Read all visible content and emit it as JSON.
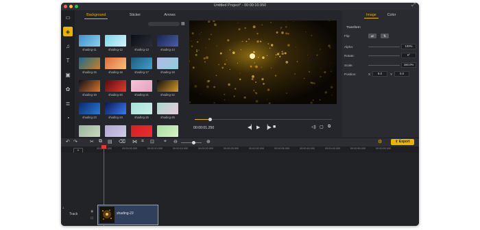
{
  "window": {
    "title": "Untitled Project* - 00:00:10.950"
  },
  "left_panel": {
    "tabs": [
      {
        "label": "Background",
        "active": true
      },
      {
        "label": "Sticker"
      },
      {
        "label": "Arrows"
      }
    ],
    "thumbnails": [
      {
        "label": "shading-11",
        "colors": [
          "#3e8fc9",
          "#8ed0f0"
        ]
      },
      {
        "label": "shading-12",
        "colors": [
          "#7ad6e8",
          "#d6f2f8"
        ]
      },
      {
        "label": "shading-13",
        "colors": [
          "#0b0d12",
          "#2b2f38"
        ]
      },
      {
        "label": "shading-14",
        "colors": [
          "#1a2450",
          "#4a5ea8"
        ]
      },
      {
        "label": "shading-15",
        "colors": [
          "#1a6a8a",
          "#c97f2a"
        ]
      },
      {
        "label": "shading-16",
        "colors": [
          "#e06a3a",
          "#f7c07a"
        ]
      },
      {
        "label": "shading-17",
        "colors": [
          "#1e5a80",
          "#3fa0c8"
        ]
      },
      {
        "label": "shading-18",
        "colors": [
          "#b7b8e8",
          "#8bd0d8"
        ]
      },
      {
        "label": "shading-19",
        "colors": [
          "#0f0f1a",
          "#d9762a"
        ]
      },
      {
        "label": "shading-20",
        "colors": [
          "#5a0a12",
          "#e23b2c"
        ]
      },
      {
        "label": "shading-21",
        "colors": [
          "#f4c4d6",
          "#e8a0c0"
        ]
      },
      {
        "label": "shading-22",
        "colors": [
          "#101010",
          "#d99a2a"
        ]
      },
      {
        "label": "shading-23",
        "colors": [
          "#0a2a70",
          "#2a7ad0"
        ]
      },
      {
        "label": "shading-24",
        "colors": [
          "#0a1a50",
          "#3a7af0"
        ]
      },
      {
        "label": "shading-25",
        "colors": [
          "#a8e0d8",
          "#c8efe8"
        ]
      },
      {
        "label": "shading-26",
        "colors": [
          "#a8dcd0",
          "#e8c8d8"
        ]
      },
      {
        "label": "",
        "colors": [
          "#9ab6a0",
          "#c8d8c0"
        ]
      },
      {
        "label": "",
        "colors": [
          "#b0a8d0",
          "#d0c8e8"
        ]
      },
      {
        "label": "",
        "colors": [
          "#d81e1e",
          "#e83030"
        ]
      },
      {
        "label": "",
        "colors": [
          "#a8e0a0",
          "#d8f0c8"
        ]
      }
    ]
  },
  "left_sidebar": {
    "icons": [
      "media-icon",
      "layers-icon",
      "audio-icon",
      "text-icon",
      "transition-icon",
      "effects-icon",
      "filter-icon",
      "cursor-icon"
    ]
  },
  "preview": {
    "timecode": "00:00:01.250",
    "progress": 0.1
  },
  "right_panel": {
    "tabs": [
      {
        "label": "Image",
        "active": true
      },
      {
        "label": "Color"
      }
    ],
    "section": "Transform",
    "flip_label": "Flip:",
    "flip_h": "⇄",
    "flip_v": "⇅",
    "alpha_label": "Alpha:",
    "alpha_value": "100%",
    "rotate_label": "Rotate:",
    "rotate_value": "0°",
    "scale_label": "Scale:",
    "scale_value": "160.0%",
    "position_label": "Position:",
    "pos_x_label": "X",
    "pos_x_value": "9.0",
    "pos_y_label": "Y",
    "pos_y_value": "0.0"
  },
  "toolbar": {
    "export_label": "Export"
  },
  "ruler": {
    "ticks": [
      "00:00:00.000",
      "00:00:05.000",
      "00:00:10.000",
      "00:00:15.000",
      "00:00:20.000",
      "00:00:25.000",
      "00:00:30.000",
      "00:00:35.000",
      "00:00:40.000",
      "00:00:45.000",
      "00:00:50.000",
      "00:00:55.000"
    ]
  },
  "timeline": {
    "track_number": "1",
    "track_label": "Track",
    "clip_label": "shading-22"
  }
}
